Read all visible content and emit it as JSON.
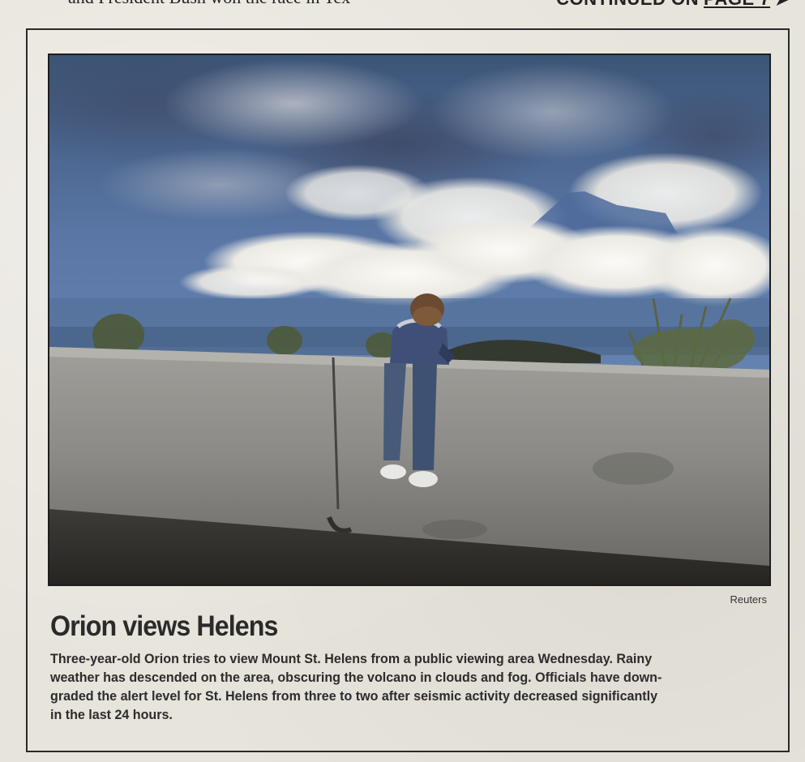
{
  "top_strip": {
    "fragment_text": "and President Bush won the race in Tex",
    "continued_label": "CONTINUED ON",
    "page_link": "PAGE 7",
    "arrow": "➤"
  },
  "photo": {
    "description_icon": "photo-child-viewing-volcano",
    "credit": "Reuters"
  },
  "story": {
    "headline": "Orion views Helens",
    "caption_lines": [
      "Three-year-old Orion tries to view Mount St. Helens from a public viewing area Wednesday. Rainy",
      "weather has descended on the area, obscuring the volcano in clouds and fog. Officials have down-",
      "graded the alert level for St. Helens from three to two after seismic activity decreased significantly",
      "in the last 24 hours."
    ]
  },
  "colors": {
    "paper": "#e7e4dc",
    "ink": "#2b2b2b",
    "sky_top": "#3f5878",
    "sky_blue": "#5a77a6",
    "cloud": "#f3f2ee",
    "wall": "#8c8c88"
  }
}
